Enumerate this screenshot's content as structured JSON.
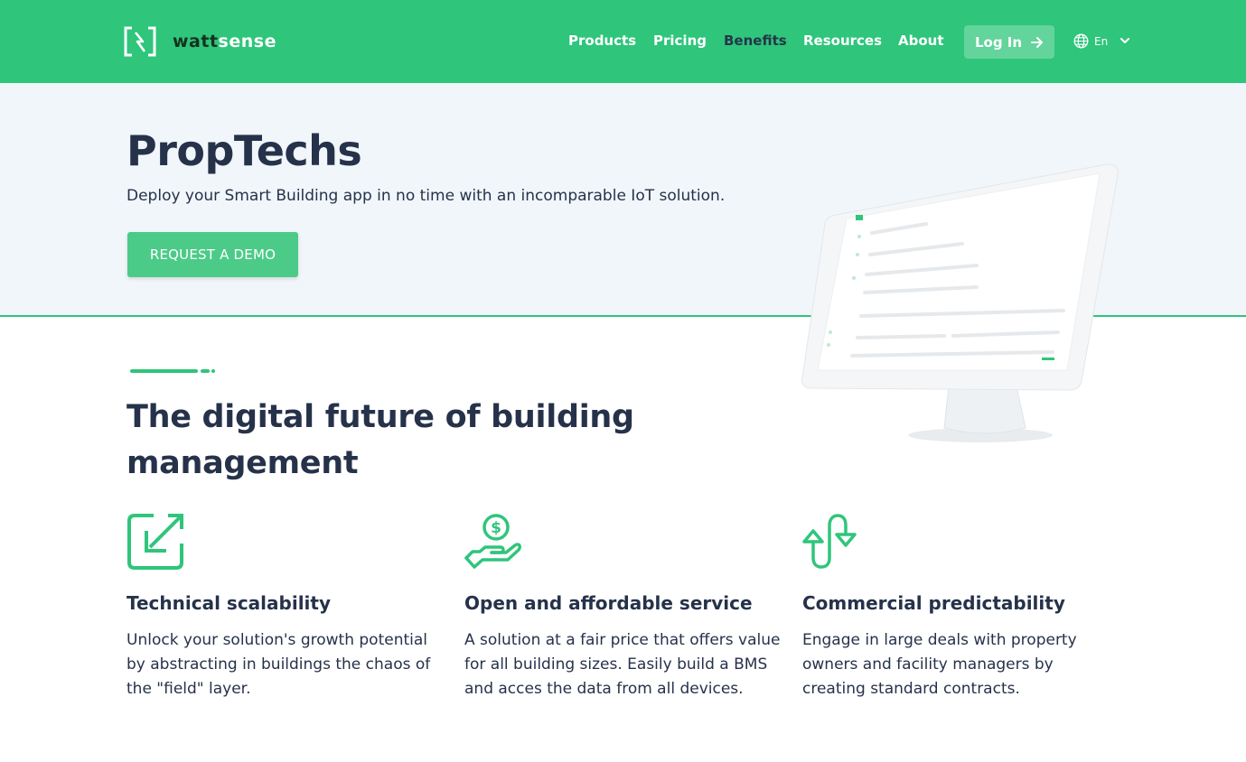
{
  "header": {
    "logo": {
      "part1": "watt",
      "part2": "sense"
    },
    "nav": [
      {
        "label": "Products",
        "active": false
      },
      {
        "label": "Pricing",
        "active": false
      },
      {
        "label": "Benefits",
        "active": true
      },
      {
        "label": "Resources",
        "active": false
      },
      {
        "label": "About",
        "active": false
      }
    ],
    "login_label": "Log In",
    "language": "En"
  },
  "hero": {
    "title": "PropTechs",
    "subtitle": "Deploy your Smart Building app in no time with an incomparable IoT solution.",
    "cta_label": "REQUEST A DEMO"
  },
  "section": {
    "title": "The digital future of building management",
    "features": [
      {
        "icon": "scalability-arrow-icon",
        "title": "Technical scalability",
        "text": "Unlock your solution's growth potential by abstracting in buildings the chaos of the \"field\" layer."
      },
      {
        "icon": "hand-coin-icon",
        "title": "Open and affordable service",
        "text": "A solution at a fair price that offers value for all building sizes. Easily build a BMS and acces the data from all devices."
      },
      {
        "icon": "up-down-arrows-icon",
        "title": "Commercial predictability",
        "text": "Engage in large deals with property owners and facility managers by creating standard contracts."
      }
    ]
  },
  "colors": {
    "brand_green": "#2fc57b",
    "button_green": "#4ccb88",
    "text_dark": "#26324a",
    "hero_bg": "#f1f6fb"
  }
}
